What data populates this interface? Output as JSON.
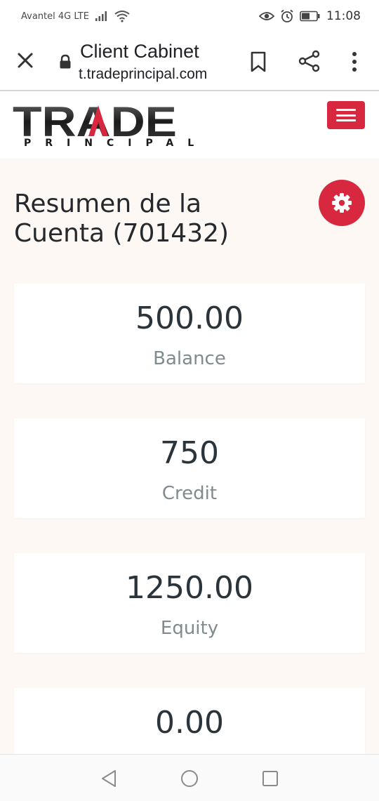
{
  "status_bar": {
    "carrier": "Avantel 4G LTE",
    "time": "11:08",
    "icons": [
      "signal-icon",
      "wifi-icon",
      "eye-icon",
      "alarm-icon",
      "battery-icon"
    ]
  },
  "browser": {
    "title": "Client Cabinet",
    "url": "t.tradeprincipal.com",
    "icons": [
      "close-icon",
      "lock-icon",
      "bookmark-icon",
      "share-icon",
      "more-vert-icon"
    ]
  },
  "site": {
    "logo_main": "TRADE",
    "logo_sub": "PRINCIPAL",
    "accent_color": "#d7283f"
  },
  "page": {
    "title": "Resumen de la Cuenta (701432)"
  },
  "cards": [
    {
      "value": "500.00",
      "label": "Balance"
    },
    {
      "value": "750",
      "label": "Credit"
    },
    {
      "value": "1250.00",
      "label": "Equity"
    },
    {
      "value": "0.00",
      "label": ""
    }
  ],
  "nav": {
    "icons": [
      "back-icon",
      "home-icon",
      "recents-icon"
    ]
  }
}
